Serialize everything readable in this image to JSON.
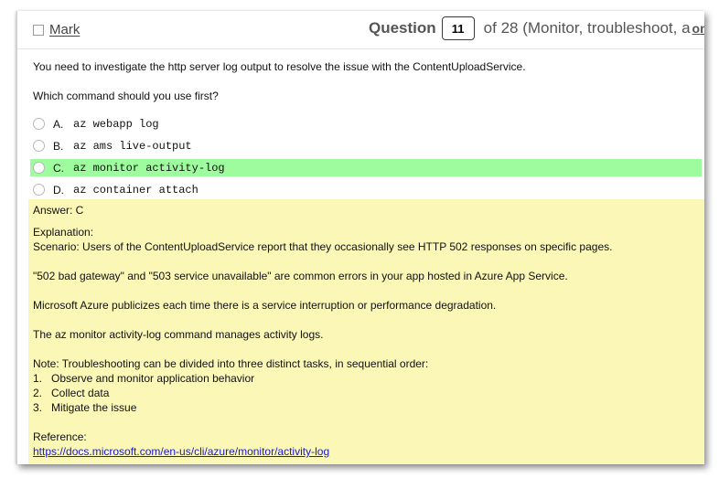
{
  "header": {
    "mark_label": "Mark",
    "question_label": "Question",
    "question_number": "11",
    "of_text": "of 28 (Monitor, troubleshoot, a",
    "trailing_link": "on"
  },
  "question": {
    "text": "You need to investigate the http server log output to resolve the issue with the ContentUploadService.",
    "prompt": "Which command should you use first?"
  },
  "options": [
    {
      "letter": "A.",
      "text": "az webapp log"
    },
    {
      "letter": "B.",
      "text": "az ams live-output"
    },
    {
      "letter": "C.",
      "text": "az monitor activity-log",
      "selected": true
    },
    {
      "letter": "D.",
      "text": "az container attach"
    }
  ],
  "answer": {
    "answer_line": "Answer: C",
    "explanation_label": "Explanation:",
    "scenario": "Scenario: Users of the ContentUploadService report that they occasionally see HTTP 502 responses on specific pages.",
    "para1": "\"502 bad gateway\" and \"503 service unavailable\" are common errors in your app hosted in Azure App Service.",
    "para2": "Microsoft Azure publicizes each time there is a service interruption or performance degradation.",
    "para3": "The az monitor activity-log command manages activity logs.",
    "note": "Note: Troubleshooting can be divided into three distinct tasks, in sequential order:",
    "steps": [
      {
        "num": "1.",
        "text": "Observe and monitor application behavior"
      },
      {
        "num": "2.",
        "text": "Collect data"
      },
      {
        "num": "3.",
        "text": "Mitigate the issue"
      }
    ],
    "reference_label": "Reference:",
    "reference_url": "https://docs.microsoft.com/en-us/cli/azure/monitor/activity-log"
  },
  "colors": {
    "selected_option_bg": "#9efb9e",
    "answer_panel_bg": "#fbf7b7",
    "link": "#1a1acc"
  }
}
